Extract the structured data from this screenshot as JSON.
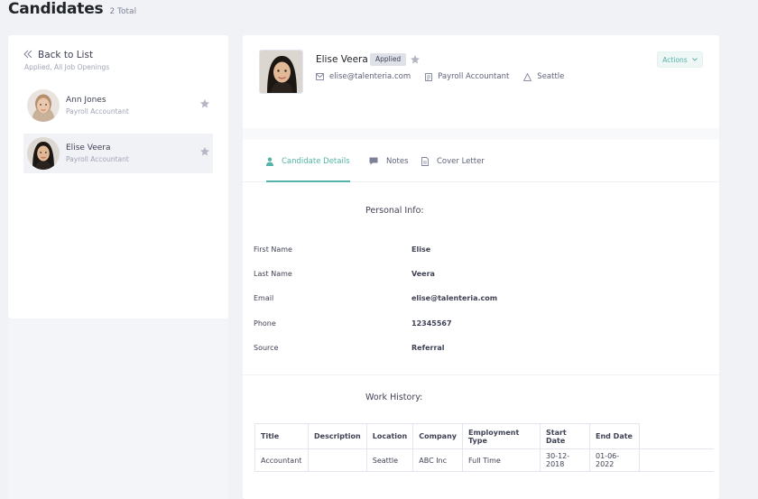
{
  "header": {
    "title": "Candidates",
    "count": "2 Total"
  },
  "sidebar": {
    "back_label": "Back to List",
    "filter_label": "Applied, All Job Openings",
    "candidates": [
      {
        "name": "Ann Jones",
        "role": "Payroll Accountant"
      },
      {
        "name": "Elise Veera",
        "role": "Payroll Accountant"
      }
    ]
  },
  "profile": {
    "name": "Elise Veera",
    "status": "Applied",
    "email": "elise@talenteria.com",
    "position": "Payroll Accountant",
    "location": "Seattle",
    "actions_label": "Actions"
  },
  "tabs": [
    {
      "label": "Candidate Details",
      "icon": "user-icon"
    },
    {
      "label": "Notes",
      "icon": "chat-icon"
    },
    {
      "label": "Cover Letter",
      "icon": "document-icon"
    }
  ],
  "personal_info": {
    "title": "Personal Info:",
    "fields": [
      {
        "label": "First Name",
        "value": "Elise"
      },
      {
        "label": "Last Name",
        "value": "Veera"
      },
      {
        "label": "Email",
        "value": "elise@talenteria.com"
      },
      {
        "label": "Phone",
        "value": "12345567"
      },
      {
        "label": "Source",
        "value": "Referral"
      }
    ]
  },
  "work_history": {
    "title": "Work History:",
    "columns": [
      "Title",
      "Description",
      "Location",
      "Company",
      "Employment Type",
      "Start Date",
      "End Date"
    ],
    "rows": [
      [
        "Accountant",
        "",
        "Seattle",
        "ABC Inc",
        "Full Time",
        "30-12-2018",
        "01-06-2022"
      ]
    ]
  },
  "colors": {
    "accent": "#54b3a7",
    "background": "#f1f2f6",
    "star": "#b5b5c3"
  }
}
